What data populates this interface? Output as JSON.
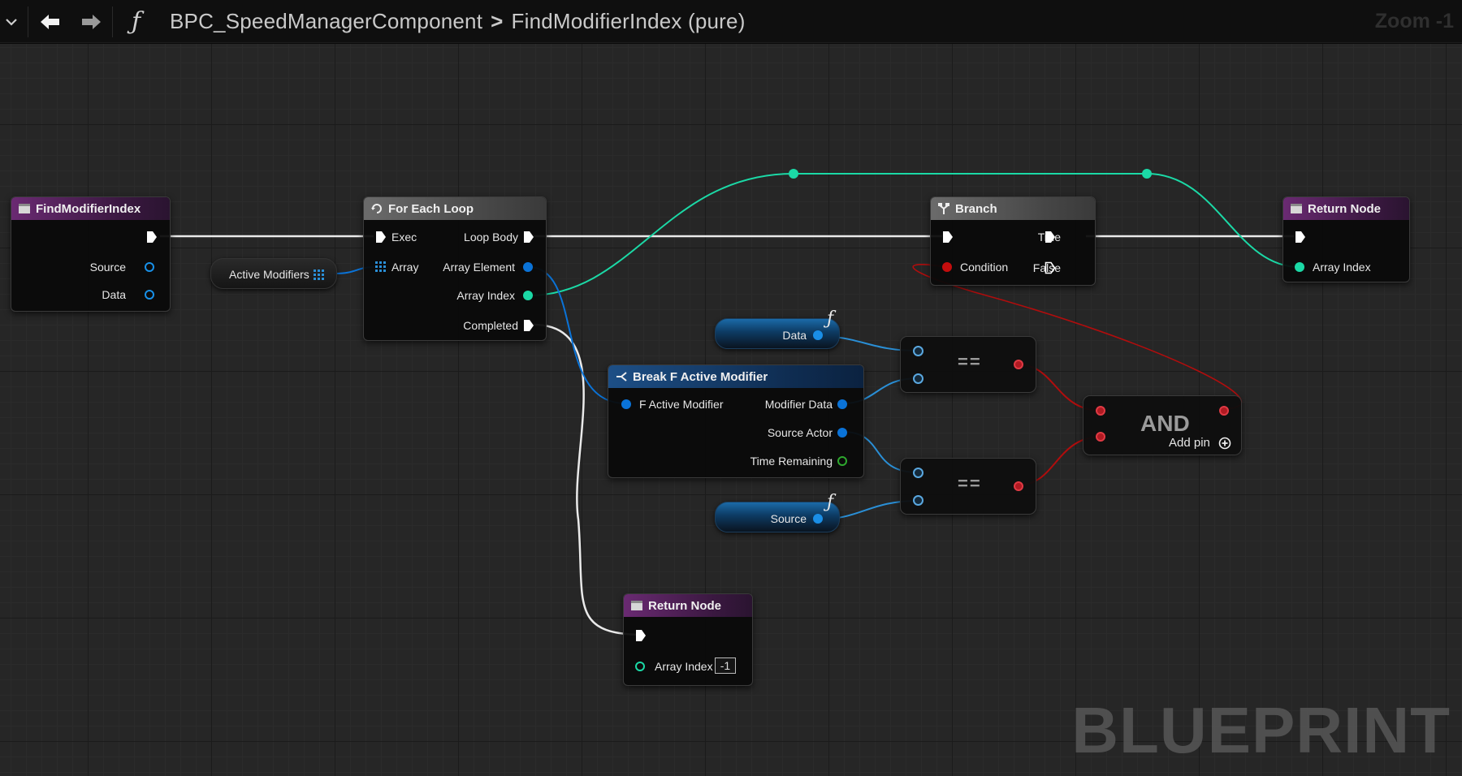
{
  "toolbar": {
    "dropdown_icon": "chevron-down-icon",
    "back_icon": "arrow-left-icon",
    "forward_icon": "arrow-right-icon",
    "function_glyph": "ƒ",
    "breadcrumb": [
      "BPC_SpeedManagerComponent",
      "FindModifierIndex (pure)"
    ],
    "breadcrumb_sep": ">",
    "zoom": "Zoom -1"
  },
  "nodes": {
    "entry": {
      "title": "FindModifierIndex",
      "pins": [
        "Source",
        "Data"
      ]
    },
    "active_modifiers": {
      "label": "Active Modifiers"
    },
    "foreach": {
      "title": "For Each Loop",
      "in": [
        "Exec",
        "Array"
      ],
      "out": [
        "Loop Body",
        "Array Element",
        "Array Index",
        "Completed"
      ]
    },
    "branch": {
      "title": "Branch",
      "condition": "Condition",
      "true": "True",
      "false": "False"
    },
    "return_top": {
      "title": "Return Node",
      "pin": "Array Index"
    },
    "data_var": {
      "label": "Data",
      "f_glyph": "ƒ"
    },
    "source_var": {
      "label": "Source",
      "f_glyph": "ƒ"
    },
    "break": {
      "title": "Break F Active Modifier",
      "in": "F Active Modifier",
      "out": [
        "Modifier Data",
        "Source Actor",
        "Time Remaining"
      ]
    },
    "eq1": {
      "op": "=="
    },
    "eq2": {
      "op": "=="
    },
    "and": {
      "op": "AND",
      "add_pin": "Add pin"
    },
    "return_bottom": {
      "title": "Return Node",
      "pin": "Array Index",
      "default": "-1"
    }
  },
  "watermark": "BLUEPRINT",
  "colors": {
    "exec": "#ffffff",
    "integer": "#1bd9a6",
    "object": "#0a73d8",
    "bool": "#c30d0d",
    "float": "#2ea82e",
    "function_header": "#6a2a72",
    "macro_header": "#6b6b6b",
    "struct_header": "#1d4f86"
  }
}
